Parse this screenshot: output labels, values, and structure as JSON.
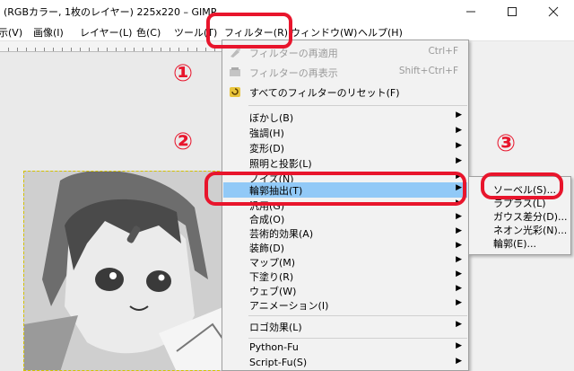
{
  "window": {
    "title": "(RGBカラー, 1枚のレイヤー) 225x220 – GIMP",
    "minimize_icon": "minimize-icon",
    "maximize_icon": "maximize-icon",
    "close_icon": "close-icon"
  },
  "menubar": {
    "items": [
      "示(V)",
      "画像(I)",
      "レイヤー(L)",
      "色(C)",
      "ツール(T)",
      "フィルター(R)",
      "ウィンドウ(W)",
      "ヘルプ(H)"
    ]
  },
  "filters_menu": {
    "top_items": [
      {
        "label": "フィルターの再適用",
        "shortcut": "Ctrl+F",
        "disabled": true,
        "icon": "reapply-filter-icon"
      },
      {
        "label": "フィルターの再表示",
        "shortcut": "Shift+Ctrl+F",
        "disabled": true,
        "icon": "reshow-filter-icon"
      },
      {
        "label": "すべてのフィルターのリセット(F)",
        "shortcut": "",
        "disabled": false,
        "icon": "reset-filters-icon"
      }
    ],
    "categories": [
      "ぼかし(B)",
      "強調(H)",
      "変形(D)",
      "照明と投影(L)",
      "ノイズ(N)",
      "輪郭抽出(T)",
      "汎用(G)",
      "合成(O)",
      "芸術的効果(A)",
      "装飾(D)",
      "マップ(M)",
      "下塗り(R)",
      "ウェブ(W)",
      "アニメーション(I)"
    ],
    "highlighted": "輪郭抽出(T)",
    "logo": "ロゴ効果(L)",
    "scripts": [
      "Python-Fu",
      "Script-Fu(S)"
    ]
  },
  "edge_detect_submenu": {
    "items": [
      "ソーベル(S)...",
      "ラプラス(L)",
      "ガウス差分(D)...",
      "ネオン光彩(N)...",
      "輪郭(E)..."
    ]
  },
  "annotations": {
    "step1": "①",
    "step2": "②",
    "step3": "③",
    "color": "#e8152c"
  },
  "colors": {
    "highlight": "#91c9f7",
    "menu_bg": "#f2f2f2"
  }
}
